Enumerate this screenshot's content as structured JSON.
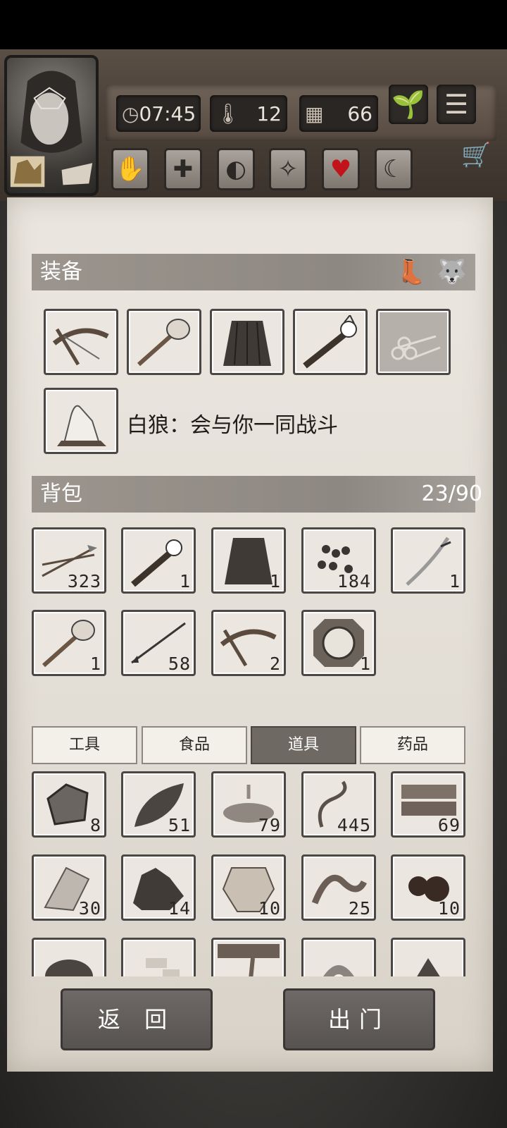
{
  "hud": {
    "time": "07:45",
    "temperature": "12",
    "days": "66",
    "icons": [
      "clock-icon",
      "thermometer-icon",
      "calendar-icon",
      "sprout-icon",
      "menu-icon"
    ],
    "status_icons": [
      "hand-icon",
      "health-cross-icon",
      "stomach-icon",
      "mind-icon",
      "heart-icon",
      "moon-icon"
    ]
  },
  "equipment": {
    "title": "装备",
    "slots": [
      "crossbow",
      "hammer",
      "grass-skirt",
      "torch",
      "firewood"
    ],
    "companion_text": "白狼：会与你一同战斗"
  },
  "backpack": {
    "title": "背包",
    "capacity": "23/90",
    "items": [
      {
        "name": "arrows",
        "count": "323"
      },
      {
        "name": "torch",
        "count": "1"
      },
      {
        "name": "grass-skirt",
        "count": "1"
      },
      {
        "name": "pellets",
        "count": "184"
      },
      {
        "name": "sabre",
        "count": "1"
      },
      {
        "name": "hammer",
        "count": "1"
      },
      {
        "name": "arrow",
        "count": "58"
      },
      {
        "name": "crossbow",
        "count": "2"
      },
      {
        "name": "compass",
        "count": "1"
      }
    ]
  },
  "tabs": [
    "工具",
    "食品",
    "道具",
    "药品"
  ],
  "active_tab": 2,
  "storage": [
    {
      "name": "stone",
      "count": "8"
    },
    {
      "name": "leaf",
      "count": "51"
    },
    {
      "name": "puddle",
      "count": "79"
    },
    {
      "name": "vine",
      "count": "445"
    },
    {
      "name": "planks",
      "count": "69"
    },
    {
      "name": "flint",
      "count": "30"
    },
    {
      "name": "ore",
      "count": "14"
    },
    {
      "name": "hide",
      "count": "10"
    },
    {
      "name": "worm",
      "count": "25"
    },
    {
      "name": "tar",
      "count": "10"
    },
    {
      "name": "herb",
      "count": ""
    },
    {
      "name": "bone-shards",
      "count": ""
    },
    {
      "name": "branch",
      "count": ""
    },
    {
      "name": "pearl",
      "count": ""
    },
    {
      "name": "dirt",
      "count": ""
    }
  ],
  "buttons": {
    "back": "返 回",
    "go_out": "出门"
  },
  "colors": {
    "paper": "#ebe7e0",
    "bar": "#8e8882",
    "wood": "#4a4038",
    "heart": "#c0141a"
  }
}
